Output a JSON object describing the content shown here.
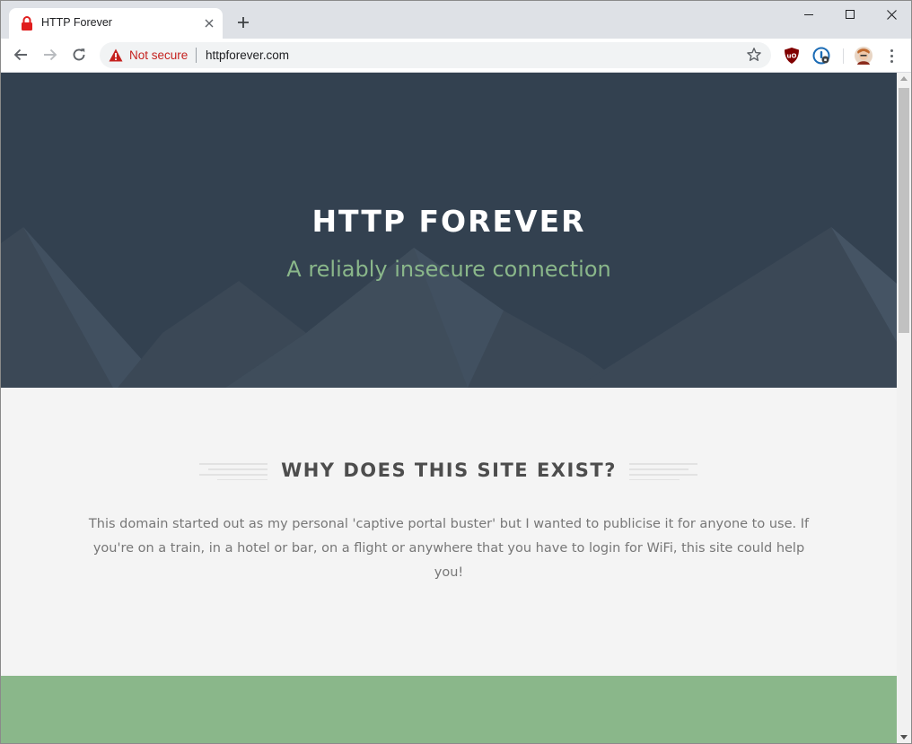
{
  "browser": {
    "tab": {
      "title": "HTTP Forever",
      "favicon": "lock-icon"
    },
    "new_tab_icon": "plus-icon",
    "window_controls": [
      "minimize-icon",
      "maximize-icon",
      "close-icon"
    ],
    "address": {
      "security_label": "Not secure",
      "url": "httpforever.com",
      "security_color": "#c5221f"
    },
    "extensions": [
      "ublock-origin-icon",
      "password-manager-icon"
    ],
    "menu_icon": "kebab-menu-icon"
  },
  "page": {
    "hero": {
      "title": "HTTP FOREVER",
      "tagline": "A reliably insecure connection",
      "background": "#334150",
      "accent": "#8ab78a"
    },
    "why": {
      "heading": "WHY DOES THIS SITE EXIST?",
      "description": "This domain started out as my personal 'captive portal buster' but I wanted to publicise it for anyone to use. If you're on a train, in a hotel or bar, on a flight or anywhere that you have to login for WiFi, this site could help you!"
    },
    "footer_band_color": "#8ab78a"
  }
}
